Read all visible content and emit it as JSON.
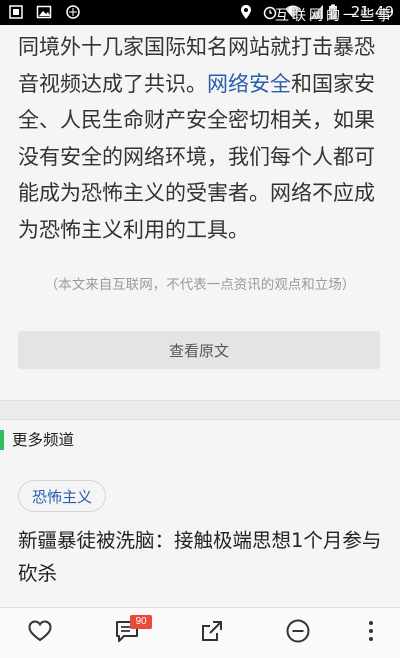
{
  "status_bar": {
    "time": "21:49",
    "overlay_text": "互联网的一些事"
  },
  "article": {
    "text_before_link": "同境外十几家国际知名网站就打击暴恐音视频达成了共识。",
    "link_text": "网络安全",
    "text_after_link": "和国家安全、人民生命财产安全密切相关，如果没有安全的网络环境，我们每个人都可能成为恐怖主义的受害者。网络不应成为恐怖主义利用的工具。",
    "disclaimer": "（本文来自互联网，不代表一点资讯的观点和立场）",
    "view_original_label": "查看原文"
  },
  "more_channels": {
    "title": "更多频道",
    "tag": "恐怖主义",
    "headline": "新疆暴徒被洗脑：接触极端思想1个月参与砍杀"
  },
  "toolbar": {
    "comment_count": "90"
  },
  "colors": {
    "link": "#2a5ea9",
    "section_accent": "#2dbd5a",
    "badge": "#e84a3c"
  },
  "icons": [
    "image-icon",
    "weather-icon",
    "location-icon",
    "alarm-icon",
    "wifi-icon",
    "signal-icon",
    "battery-icon",
    "heart-icon",
    "comment-icon",
    "share-icon",
    "minus-circle-icon",
    "more-vertical-icon"
  ]
}
